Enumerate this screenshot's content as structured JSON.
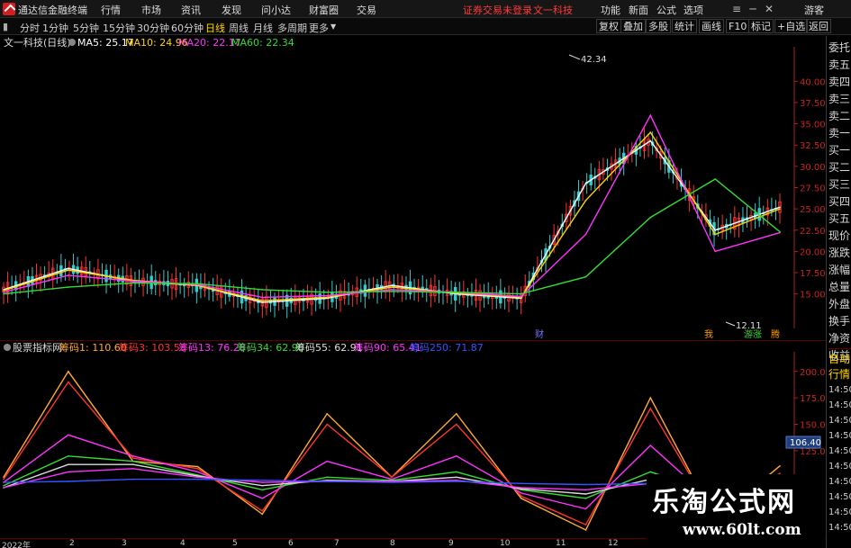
{
  "app": {
    "title": "通达信金融终端",
    "menu": [
      "行情",
      "市场",
      "资讯",
      "发现",
      "问小达",
      "财富圈",
      "交易"
    ],
    "notice": "证券交易未登录",
    "stock_name_top": "文一科技",
    "right_menu": [
      "功能",
      "新面",
      "公式",
      "选项",
      "游客"
    ]
  },
  "toolbar": {
    "periods": [
      "分时",
      "1分钟",
      "5分钟",
      "15分钟",
      "30分钟",
      "60分钟",
      "日线",
      "周线",
      "月线",
      "多周期",
      "更多"
    ],
    "active_period": "日线",
    "right_buttons": [
      "复权",
      "叠加",
      "多股",
      "统计",
      "画线",
      "F10",
      "标记",
      "+自选",
      "返回"
    ]
  },
  "main_chart": {
    "stock_label": "文一科技(日线)",
    "ma": [
      {
        "label": "MA5: 25.17",
        "color": "#ffffff"
      },
      {
        "label": "MA10: 24.96",
        "color": "#ffd400"
      },
      {
        "label": "MA20: 22.17",
        "color": "#ff33ff"
      },
      {
        "label": "MA60: 22.34",
        "color": "#33dd33"
      }
    ],
    "high_label": "42.34",
    "low_label": "12.11",
    "markers": [
      {
        "text": "财",
        "color": "#7777ff"
      },
      {
        "text": "我",
        "color": "#ff9900"
      },
      {
        "text": "游涨",
        "color": "#33dd33"
      },
      {
        "text": "腾",
        "color": "#ff9900"
      }
    ]
  },
  "sub_chart": {
    "title": "股票指标网",
    "items": [
      {
        "label": "筹码1: 110.60",
        "color": "#ffaa33"
      },
      {
        "label": "筹码3: 103.53",
        "color": "#ff3333"
      },
      {
        "label": "筹码13: 76.28",
        "color": "#ff33ff"
      },
      {
        "label": "筹码34: 62.90",
        "color": "#33dd33"
      },
      {
        "label": "筹码55: 62.91",
        "color": "#dddddd"
      },
      {
        "label": "筹码90: 65.41",
        "color": "#ff33ff"
      },
      {
        "label": "筹码250: 71.87",
        "color": "#3355ff"
      }
    ],
    "current_value": "106.40"
  },
  "right_panel": {
    "labels": [
      "委托",
      "卖五",
      "卖四",
      "卖三",
      "卖二",
      "卖一",
      "买一",
      "买二",
      "买三",
      "买四",
      "买五",
      "现价",
      "涨跌",
      "涨幅",
      "总量",
      "外盘",
      "换手",
      "净资",
      "收益"
    ],
    "lower_labels": [
      "自动",
      "行情"
    ],
    "times": [
      "14:50",
      "14:50",
      "14:50",
      "14:50",
      "14:50",
      "14:50",
      "14:50",
      "14:50",
      "14:50",
      "14:50"
    ]
  },
  "date_axis": [
    "2022年",
    "2",
    "3",
    "4",
    "5",
    "6",
    "7",
    "8",
    "9",
    "10",
    "11",
    "12"
  ],
  "watermark": {
    "cn": "乐淘公式网",
    "url": "www.60lt.com"
  },
  "chart_data": [
    {
      "type": "line",
      "title": "文一科技(日线)",
      "xlabel": "",
      "ylabel": "",
      "ylim": [
        12,
        43
      ],
      "y_ticks": [
        15.0,
        17.5,
        20.0,
        22.5,
        25.0,
        27.5,
        30.0,
        32.5,
        35.0,
        37.5,
        40.0
      ],
      "grid": false,
      "x": [
        "2022-01",
        "2022-02",
        "2022-03",
        "2022-04",
        "2022-05",
        "2022-06",
        "2022-07",
        "2022-08",
        "2022-09",
        "2022-10",
        "2022-11",
        "2022-12",
        "2023-01"
      ],
      "series": [
        {
          "name": "MA5",
          "values": [
            15.5,
            18.0,
            16.5,
            16.0,
            14.0,
            14.5,
            16.0,
            15.0,
            14.5,
            28.0,
            33.0,
            22.5,
            25.2
          ]
        },
        {
          "name": "MA10",
          "values": [
            15.4,
            17.8,
            16.6,
            16.0,
            14.2,
            14.6,
            15.8,
            15.1,
            14.6,
            26.0,
            34.0,
            22.0,
            25.0
          ]
        },
        {
          "name": "MA20",
          "values": [
            15.2,
            17.2,
            16.5,
            16.1,
            14.6,
            14.8,
            15.5,
            15.2,
            14.7,
            22.0,
            36.0,
            20.0,
            22.2
          ]
        },
        {
          "name": "MA60",
          "values": [
            15.0,
            15.8,
            16.3,
            16.2,
            15.5,
            15.2,
            15.3,
            15.2,
            15.0,
            17.0,
            24.0,
            28.5,
            22.3
          ]
        }
      ]
    },
    {
      "type": "line",
      "title": "股票指标网",
      "xlabel": "",
      "ylabel": "",
      "ylim": [
        50,
        210
      ],
      "y_ticks": [
        100,
        125,
        150,
        175,
        200
      ],
      "grid": false,
      "x": [
        "2022-01",
        "2022-02",
        "2022-03",
        "2022-04",
        "2022-05",
        "2022-06",
        "2022-07",
        "2022-08",
        "2022-09",
        "2022-10",
        "2022-11",
        "2022-12",
        "2023-01"
      ],
      "series": [
        {
          "name": "筹码1",
          "values": [
            100,
            200,
            115,
            110,
            65,
            160,
            100,
            160,
            80,
            50,
            175,
            60,
            110.6
          ]
        },
        {
          "name": "筹码3",
          "values": [
            98,
            190,
            118,
            108,
            68,
            150,
            100,
            150,
            82,
            55,
            165,
            62,
            103.5
          ]
        },
        {
          "name": "筹码13",
          "values": [
            95,
            140,
            120,
            105,
            80,
            115,
            98,
            120,
            85,
            70,
            130,
            75,
            76.3
          ]
        },
        {
          "name": "筹码34",
          "values": [
            92,
            120,
            115,
            102,
            88,
            100,
            97,
            105,
            88,
            80,
            105,
            85,
            62.9
          ]
        },
        {
          "name": "筹码55",
          "values": [
            90,
            112,
            112,
            101,
            92,
            97,
            96,
            100,
            89,
            84,
            98,
            88,
            62.9
          ]
        },
        {
          "name": "筹码90",
          "values": [
            90,
            105,
            108,
            100,
            95,
            96,
            96,
            97,
            90,
            88,
            94,
            90,
            65.4
          ]
        },
        {
          "name": "筹码250",
          "values": [
            95,
            96,
            98,
            98,
            97,
            96,
            95,
            96,
            94,
            93,
            94,
            93,
            71.9
          ]
        }
      ]
    }
  ]
}
